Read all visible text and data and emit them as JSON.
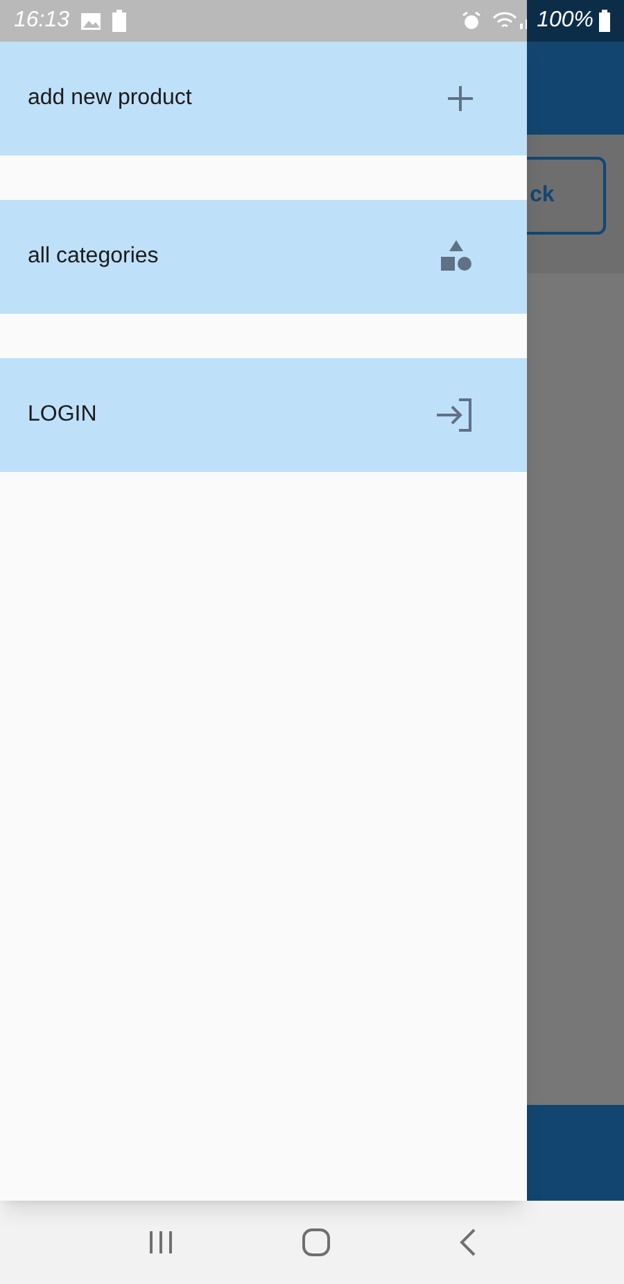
{
  "status_bar": {
    "time": "16:13",
    "battery": "100%"
  },
  "drawer": {
    "items": [
      {
        "label": "add new product"
      },
      {
        "label": "all categories"
      },
      {
        "label": "LOGIN"
      }
    ]
  },
  "background": {
    "button": "ck"
  }
}
